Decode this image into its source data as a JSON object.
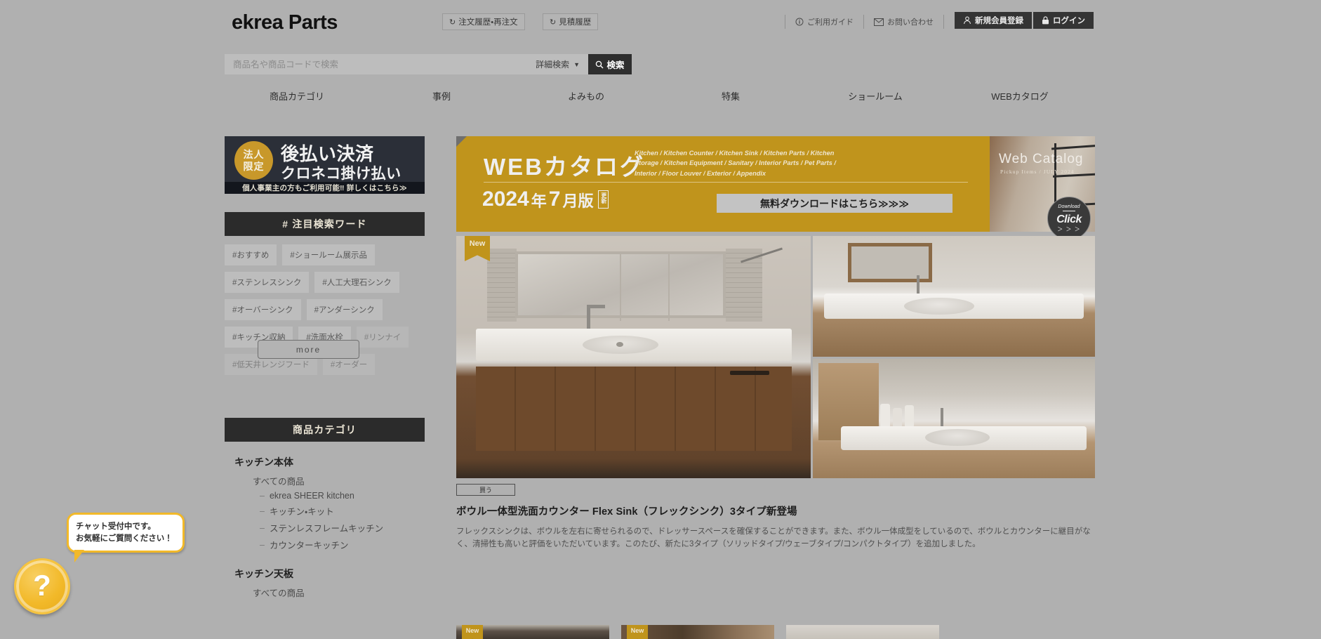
{
  "site": {
    "logo": "ekrea Parts"
  },
  "header": {
    "order_history": "注文履歴・再注文",
    "quote_history": "見積履歴",
    "links": [
      {
        "label": "ご利用ガイド",
        "icon": "info-icon"
      },
      {
        "label": "お問い合わせ",
        "icon": "mail-icon"
      }
    ],
    "register": "新規会員登録",
    "login": "ログイン"
  },
  "search": {
    "placeholder": "商品名や商品コードで検索",
    "value": "",
    "advanced": "詳細検索",
    "button": "検索"
  },
  "nav": {
    "items": [
      {
        "label": "商品カテゴリ"
      },
      {
        "label": "事例"
      },
      {
        "label": "よみもの"
      },
      {
        "label": "特集"
      },
      {
        "label": "ショールーム"
      },
      {
        "label": "WEBカタログ"
      }
    ]
  },
  "sidebar": {
    "banner": {
      "badge_line1": "法人",
      "badge_line2": "限定",
      "title1": "後払い決済",
      "title2": "クロネコ掛け払い",
      "footer": "個人事業主の方もご利用可能‼ 詳しくはこちら≫"
    },
    "keywords_panel": {
      "title": "# 注目検索ワード",
      "more": "more",
      "tags": [
        "#おすすめ",
        "#ショールーム展示品",
        "#ステンレスシンク",
        "#人工大理石シンク",
        "#オーバーシンク",
        "#アンダーシンク",
        "#キッチン収納",
        "#洗面水栓",
        "#リンナイ",
        "#低天井レンジフード",
        "#オーダー"
      ]
    },
    "category_panel": {
      "title": "商品カテゴリ",
      "groups": [
        {
          "name": "キッチン本体",
          "all": "すべての商品",
          "items": [
            "ekrea SHEER kitchen",
            "キッチン・キット",
            "ステンレスフレームキッチン",
            "カウンターキッチン"
          ]
        },
        {
          "name": "キッチン天板",
          "all": "すべての商品",
          "items": []
        }
      ]
    }
  },
  "main": {
    "hero": {
      "title": "WEBカタログ",
      "categories": "Kitchen / Kitchen Counter / Kitchen Sink / Kitchen Parts / Kitchen Storage / Kitchen Equipment / Sanitary / Interior Parts / Pet Parts / Interior / Floor Louver / Exterior / Appendix",
      "version_year": "2024",
      "version_nen": "年",
      "version_month": "7",
      "version_gatsu": "月版",
      "update_badge": "更新",
      "download_button": "無料ダウンロードはこちら≫≫≫",
      "cover_title": "Web Catalog",
      "cover_sub": "Pickup Items  /  JULY 2024",
      "click_badge_top": "Download",
      "click_badge_main": "Click",
      "click_badge_arrows": "＞ ＞ ＞"
    },
    "feature": {
      "new_badge": "New",
      "buy_button": "買う",
      "title": "ボウル一体型洗面カウンター Flex Sink（フレックシンク）3タイプ新登場",
      "description": "フレックスシンクは、ボウルを左右に寄せられるので、ドレッサースペースを確保することができます。また、ボウル一体成型をしているので、ボウルとカウンターに継目がなく、清掃性も高いと評価をいただいています。このたび、新たに3タイプ（ソリッドタイプ/ウェーブタイプ/コンパクトタイプ）を追加しました。"
    },
    "thumbnails": [
      {
        "new_badge": "New"
      },
      {
        "new_badge": "New"
      },
      {
        "new_badge": ""
      }
    ]
  },
  "chat": {
    "message_line1": "チャット受付中です。",
    "message_line2": "お気軽にご質問ください！",
    "fab_glyph": "?"
  },
  "colors": {
    "accent_gold": "#c0941c",
    "dark": "#2b2b2b",
    "page_bg": "#b0b0b0",
    "chat_yellow": "#f2b929"
  }
}
